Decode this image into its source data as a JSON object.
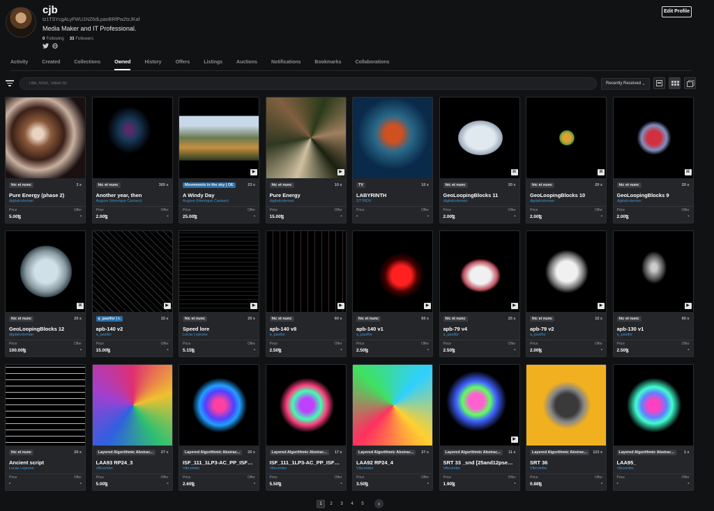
{
  "profile": {
    "name": "cjb",
    "address": "tz1TSYcgALyFWU1NZ6dLpaoBRfPw2tzJKaf",
    "bio": "Media Maker and IT Professional.",
    "following_count": "0",
    "following_label": "Following",
    "followers_count": "33",
    "followers_label": "Followers",
    "twitter_icon": "twitter-icon",
    "web_icon": "globe-icon",
    "edit_label": "Edit Profile"
  },
  "tabs": [
    "Activity",
    "Created",
    "Collections",
    "Owned",
    "History",
    "Offers",
    "Listings",
    "Auctions",
    "Notifications",
    "Bookmarks",
    "Collaborations"
  ],
  "active_tab": "Owned",
  "toolbar": {
    "search_placeholder": "Title, Artist, Token ID",
    "sort_label": "Recently Received"
  },
  "price_label": "Price",
  "offer_label": "Offer",
  "cards": [
    {
      "tag": "hic et nunc",
      "count": "3 x",
      "title": "Pure Energy (phase 2)",
      "artist": "digitalcoleman",
      "price": "5.00ꜩ",
      "offer": "-",
      "media": ""
    },
    {
      "tag": "hic et nunc",
      "count": "305 x",
      "title": "Another year, then",
      "artist": "Augure (Henrique Cartaxo)",
      "price": "2.00ꜩ",
      "offer": "-",
      "media": ""
    },
    {
      "tag": "Movements in the sky | OE",
      "tag_blue": true,
      "count": "23 x",
      "title": "A Windy Day",
      "artist": "Augure (Henrique Cartaxo)",
      "price": "25.00ꜩ",
      "offer": "-",
      "media": "▶"
    },
    {
      "tag": "hic et nunc",
      "count": "10 x",
      "title": "Pure Energy",
      "artist": "digitalcoleman",
      "price": "15.00ꜩ",
      "offer": "-",
      "media": "▶"
    },
    {
      "tag": "TV",
      "count": "10 x",
      "title": "LABYRINTH",
      "artist": "ST7RDV",
      "price": "-",
      "offer": "-",
      "media": ""
    },
    {
      "tag": "hic et nunc",
      "count": "20 x",
      "title": "GeoLoopingBlocks 11",
      "artist": "digitalcoleman",
      "price": "2.00ꜩ",
      "offer": "-",
      "media": "⌘"
    },
    {
      "tag": "hic et nunc",
      "count": "20 x",
      "title": "GeoLoopingBlocks 10",
      "artist": "digitalcoleman",
      "price": "2.00ꜩ",
      "offer": "-",
      "media": "⌘"
    },
    {
      "tag": "hic et nunc",
      "count": "20 x",
      "title": "GeoLoopingBlocks 9",
      "artist": "digitalcoleman",
      "price": "2.00ꜩ",
      "offer": "-",
      "media": "⌘"
    },
    {
      "tag": "hic et nunc",
      "count": "20 x",
      "title": "GeoLoopingBlocks 12",
      "artist": "digitalcoleman",
      "price": "100.00ꜩ",
      "offer": "-",
      "media": "⌘"
    },
    {
      "tag": "a_pasifor | t.",
      "tag_blue": true,
      "count": "15 x",
      "title": "apb-140 v2",
      "artist": "a_pasifor",
      "price": "15.00ꜩ",
      "offer": "-",
      "media": "▶"
    },
    {
      "tag": "hic et nunc",
      "count": "20 x",
      "title": "Speed lore",
      "artist": "Lucas Lejeune",
      "price": "5.15ꜩ",
      "offer": "-",
      "media": "▶"
    },
    {
      "tag": "hic et nunc",
      "count": "60 x",
      "title": "apb-140 v8",
      "artist": "a_pasifor",
      "price": "2.50ꜩ",
      "offer": "-",
      "media": "▶"
    },
    {
      "tag": "hic et nunc",
      "count": "60 x",
      "title": "apb-140 v1",
      "artist": "a_pasifor",
      "price": "2.50ꜩ",
      "offer": "-",
      "media": "▶"
    },
    {
      "tag": "hic et nunc",
      "count": "25 x",
      "title": "apb-79 v4",
      "artist": "a_pasifor",
      "price": "2.50ꜩ",
      "offer": "-",
      "media": "▶"
    },
    {
      "tag": "hic et nunc",
      "count": "15 x",
      "title": "apb-79 v2",
      "artist": "a_pasifor",
      "price": "2.00ꜩ",
      "offer": "-",
      "media": "▶"
    },
    {
      "tag": "hic et nunc",
      "count": "60 x",
      "title": "apb-130 v1",
      "artist": "a_pasifor",
      "price": "2.50ꜩ",
      "offer": "-",
      "media": "▶"
    },
    {
      "tag": "hic et nunc",
      "count": "20 x",
      "title": "Ancient script",
      "artist": "Lucas Lejeune",
      "price": "-",
      "offer": "-",
      "media": ""
    },
    {
      "tag": "Layered Algorithmic Abstrac...",
      "count": "27 x",
      "title": "LAA93 RP24_3",
      "artist": "Vibcombo",
      "price": "5.00ꜩ",
      "offer": "-",
      "media": ""
    },
    {
      "tag": "Layered Algorithmic Abstrac...",
      "count": "20 x",
      "title": "ISF_111_1LP3-AC_PP_ISFL1135",
      "artist": "Vibcombo",
      "price": "2.60ꜩ",
      "offer": "-",
      "media": ""
    },
    {
      "tag": "Layered Algorithmic Abstrac...",
      "count": "17 x",
      "title": "ISF_111_1LP3-AC_PP_ISFL1136",
      "artist": "Vibcombo",
      "price": "5.50ꜩ",
      "offer": "-",
      "media": ""
    },
    {
      "tag": "Layered Algorithmic Abstrac...",
      "count": "27 x",
      "title": "LAA92 RP24_4",
      "artist": "Vibcombo",
      "price": "3.50ꜩ",
      "offer": "-",
      "media": ""
    },
    {
      "tag": "Layered Algorithmic Abstrac...",
      "count": "11 x",
      "title": "SRT 33 _snd [25and12pseudo r...",
      "artist": "Vibcombo",
      "price": "1.90ꜩ",
      "offer": "-",
      "media": "▶"
    },
    {
      "tag": "Layered Algorithmic Abstrac...",
      "count": "123 x",
      "title": "SRT 36",
      "artist": "Vibcombo",
      "price": "0.88ꜩ",
      "offer": "-",
      "media": ""
    },
    {
      "tag": "Layered Algorithmic Abstrac...",
      "count": "1 x",
      "title": "LAA95_",
      "artist": "Vibcombo",
      "price": "-",
      "offer": "-",
      "media": ""
    }
  ],
  "pagination": {
    "pages": [
      "1",
      "2",
      "3",
      "4",
      "5"
    ],
    "active": "1",
    "next_icon": "chevron-right-icon"
  }
}
